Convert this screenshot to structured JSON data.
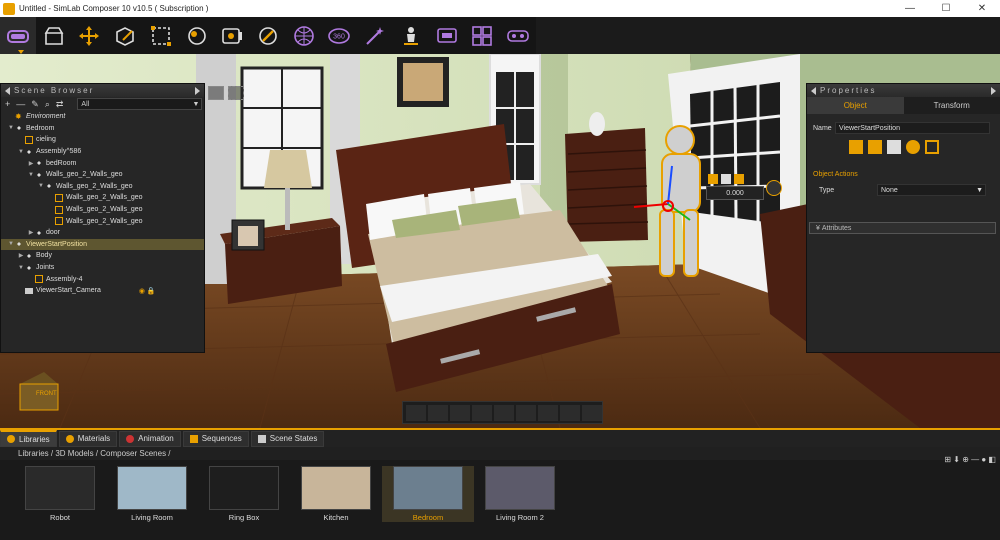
{
  "window": {
    "title": "Untitled - SimLab Composer 10 v10.5 ( Subscription )",
    "minimize": "—",
    "maximize": "☐",
    "close": "✕"
  },
  "toolbar": {
    "items": [
      "vr-viewer-icon",
      "library-icon",
      "move-icon",
      "edit-icon",
      "select-icon",
      "materials-icon",
      "render-icon",
      "lighting-icon",
      "environment-icon",
      "360-icon",
      "effects-icon",
      "character-icon",
      "screen-icon",
      "scene-states-icon",
      "vr-headset-icon"
    ]
  },
  "scene_browser": {
    "title": "Scene Browser",
    "filter_value": "All",
    "tools": [
      "+",
      "—",
      "✎",
      "⌕",
      "⇄"
    ],
    "tree": [
      {
        "indent": 0,
        "label": "Environment",
        "twist": "",
        "icon": "env"
      },
      {
        "indent": 0,
        "label": "Bedroom",
        "twist": "▼",
        "icon": "grp"
      },
      {
        "indent": 1,
        "label": "cieling",
        "twist": "",
        "icon": "box"
      },
      {
        "indent": 1,
        "label": "Assembly^586",
        "twist": "▼",
        "icon": "grp"
      },
      {
        "indent": 2,
        "label": "bedRoom",
        "twist": "▶",
        "icon": "grp"
      },
      {
        "indent": 2,
        "label": "Walls_geo_2_Walls_geo",
        "twist": "▼",
        "icon": "grp"
      },
      {
        "indent": 3,
        "label": "Walls_geo_2_Walls_geo",
        "twist": "▼",
        "icon": "grp"
      },
      {
        "indent": 4,
        "label": "Walls_geo_2_Walls_geo",
        "twist": "",
        "icon": "box"
      },
      {
        "indent": 4,
        "label": "Walls_geo_2_Walls_geo",
        "twist": "",
        "icon": "box"
      },
      {
        "indent": 4,
        "label": "Walls_geo_2_Walls_geo",
        "twist": "",
        "icon": "box"
      },
      {
        "indent": 2,
        "label": "door",
        "twist": "▶",
        "icon": "grp"
      },
      {
        "indent": 0,
        "label": "ViewerStartPosition",
        "twist": "▼",
        "icon": "grp",
        "highlight": true
      },
      {
        "indent": 1,
        "label": "Body",
        "twist": "▶",
        "icon": "grp"
      },
      {
        "indent": 1,
        "label": "Joints",
        "twist": "▼",
        "icon": "grp"
      },
      {
        "indent": 2,
        "label": "Assembly-4",
        "twist": "",
        "icon": "box"
      },
      {
        "indent": 1,
        "label": "ViewerStart_Camera",
        "twist": "",
        "icon": "cam"
      }
    ]
  },
  "properties": {
    "title": "Properties",
    "tabs": [
      "Object",
      "Transform"
    ],
    "name_label": "Name",
    "name_value": "ViewerStartPosition",
    "object_actions": "Object Actions",
    "type_label": "Type",
    "type_value": "None",
    "attributes": "Attributes"
  },
  "viewport": {
    "value_field": "0.000",
    "cube_label": "FRONT"
  },
  "library": {
    "tabs": [
      "Libraries",
      "Materials",
      "Animation",
      "Sequences",
      "Scene States"
    ],
    "breadcrumb": "Libraries  /  3D Models  /  Composer Scenes  /",
    "items": [
      {
        "label": "Robot"
      },
      {
        "label": "Living Room"
      },
      {
        "label": "Ring Box"
      },
      {
        "label": "Kitchen"
      },
      {
        "label": "Bedroom",
        "selected": true
      },
      {
        "label": "Living Room 2"
      }
    ],
    "tools": "⊞  ⬇  ⊕  —  ● ◧"
  },
  "colors": {
    "accent": "#e8a000",
    "panel": "#262626",
    "floor": "#6b3d1e",
    "wall": "#dfe8c8"
  }
}
